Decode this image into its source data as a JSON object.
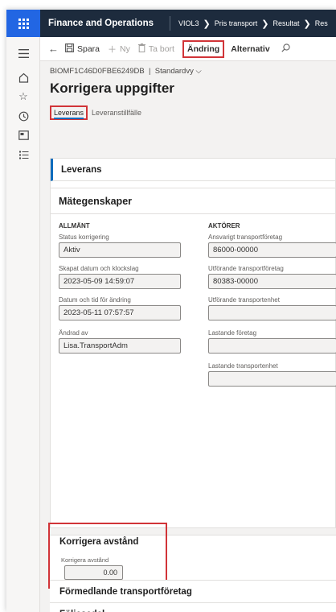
{
  "topbar": {
    "app_title": "Finance and Operations",
    "breadcrumbs": [
      "VIOL3",
      "Pris transport",
      "Resultat",
      "Res"
    ]
  },
  "actions": {
    "save": "Spara",
    "new": "Ny",
    "delete": "Ta bort",
    "change": "Ändring",
    "options": "Alternativ"
  },
  "header": {
    "record_id": "BIOMF1C46D0FBE6249DB",
    "view": "Standardvy",
    "title": "Korrigera uppgifter"
  },
  "tabs": {
    "active": "Leverans",
    "other": "Leveranstillfälle"
  },
  "leverans": {
    "header": "Leverans",
    "section_title": "Mätegenskaper",
    "allmant": {
      "heading": "ALLMÄNT",
      "status_label": "Status korrigering",
      "status_value": "Aktiv",
      "created_label": "Skapat datum och klockslag",
      "created_value": "2023-05-09 14:59:07",
      "changed_label": "Datum och tid för ändring",
      "changed_value": "2023-05-11 07:57:57",
      "changed_by_label": "Ändrad av",
      "changed_by_value": "Lisa.TransportAdm"
    },
    "aktorer": {
      "heading": "AKTÖRER",
      "resp_label": "Ansvarigt transportföretag",
      "resp_value": "86000-00000",
      "exec_label": "Utförande transportföretag",
      "exec_value": "80383-00000",
      "exec_unit_label": "Utförande transportenhet",
      "exec_unit_value": "",
      "load_comp_label": "Lastande företag",
      "load_comp_value": "",
      "load_unit_label": "Lastande transportenhet",
      "load_unit_value": ""
    }
  },
  "korrigera": {
    "title": "Korrigera avstånd",
    "label": "Korrigera avstånd",
    "value": "0.00"
  },
  "sections": {
    "broker": "Förmedlande transportföretag",
    "waybill": "Följesedel"
  }
}
